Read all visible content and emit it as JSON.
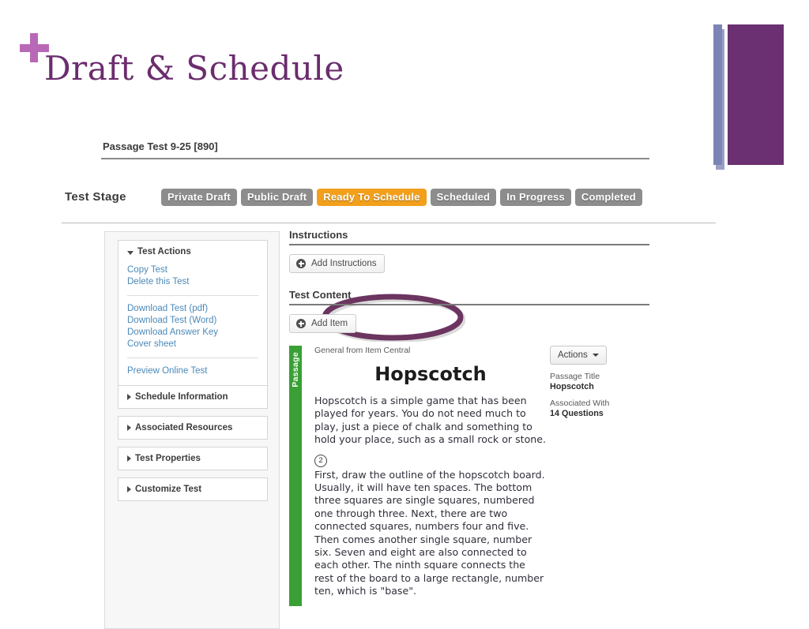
{
  "slide": {
    "title": "Draft & Schedule",
    "plus_icon": "plus-icon",
    "accent_purple": "#6b2d6e",
    "accent_orchid": "#b968b8",
    "deco_blue": "#7b84b4"
  },
  "app": {
    "test_name": "Passage Test 9-25 [890]",
    "stage": {
      "label": "Test Stage",
      "highlight_color": "#f2a01c",
      "annotation_color": "#6b3560",
      "items": [
        {
          "label": "Private Draft",
          "active": false
        },
        {
          "label": "Public Draft",
          "active": false
        },
        {
          "label": "Ready To Schedule",
          "active": true
        },
        {
          "label": "Scheduled",
          "active": false
        },
        {
          "label": "In Progress",
          "active": false
        },
        {
          "label": "Completed",
          "active": false
        }
      ]
    },
    "sidebar": {
      "panels": [
        {
          "title": "Test Actions",
          "expanded": true,
          "caret": "caret-down-icon",
          "groups": [
            [
              "Copy Test",
              "Delete this Test"
            ],
            [
              "Download Test (pdf)",
              "Download Test (Word)",
              "Download Answer Key",
              "Cover sheet"
            ],
            [
              "Preview Online Test"
            ]
          ]
        },
        {
          "title": "Schedule Information",
          "expanded": false,
          "caret": "caret-right-icon",
          "groups": []
        },
        {
          "title": "Associated Resources",
          "expanded": false,
          "caret": "caret-right-icon",
          "groups": []
        },
        {
          "title": "Test Properties",
          "expanded": false,
          "caret": "caret-right-icon",
          "groups": []
        },
        {
          "title": "Customize Test",
          "expanded": false,
          "caret": "caret-right-icon",
          "groups": []
        }
      ]
    },
    "instructions": {
      "heading": "Instructions",
      "add_button": "Add Instructions",
      "add_icon": "plus-circle-icon"
    },
    "test_content": {
      "heading": "Test Content",
      "add_button": "Add Item",
      "add_icon": "plus-circle-icon"
    },
    "passage": {
      "tab_label": "Passage",
      "tab_color": "#3aa035",
      "source": "General from Item Central",
      "title": "Hopscotch",
      "paragraph_1": "Hopscotch is a simple game that has been played for years. You do not need much to play, just a piece of chalk and something to hold your place, such as a small rock or stone.",
      "paragraph_2_marker": "2",
      "paragraph_2": "First, draw the outline of the hopscotch board. Usually, it will have ten spaces. The bottom three squares are single squares, numbered one through three. Next, there are two connected squares, numbers four and five. Then comes another single square, number six. Seven and eight are also connected to each other. The ninth square connects the rest of the board to a large rectangle, number ten, which is \"base\".",
      "meta": {
        "actions_button": "Actions",
        "caret": "caret-down-icon",
        "title_label": "Passage Title",
        "title_value": "Hopscotch",
        "assoc_label": "Associated With",
        "assoc_value": "14 Questions"
      }
    }
  }
}
